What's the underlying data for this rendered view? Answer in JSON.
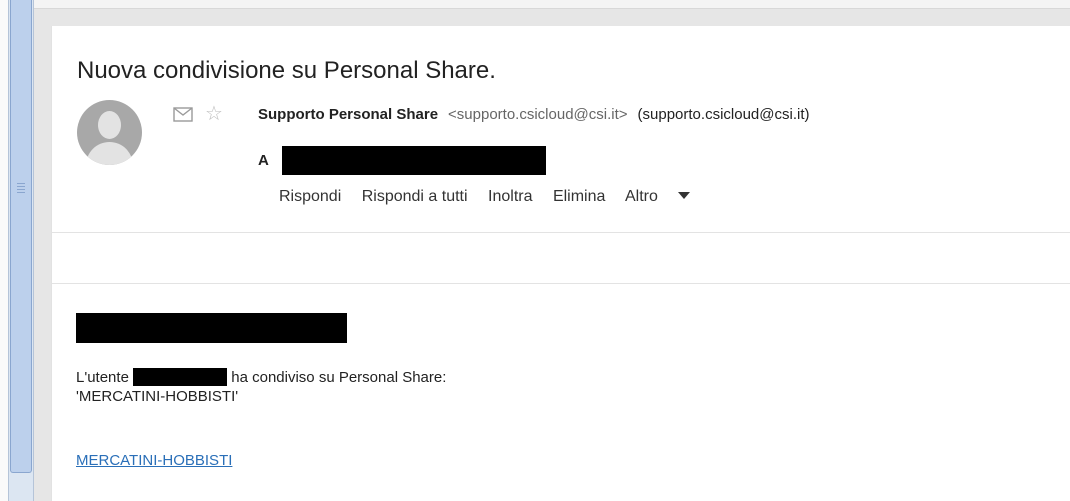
{
  "email": {
    "subject": "Nuova condivisione su Personal Share.",
    "sender_name": "Supporto Personal Share",
    "sender_email": "<supporto.csicloud@csi.it>",
    "sender_email_alt": "(supporto.csicloud@csi.it)",
    "to_label": "A",
    "actions": {
      "reply": "Rispondi",
      "reply_all": "Rispondi a tutti",
      "forward": "Inoltra",
      "delete": "Elimina",
      "more": "Altro"
    },
    "body": {
      "line1_prefix": "L'utente",
      "line1_suffix": "ha condiviso su Personal Share:",
      "line2": "'MERCATINI-HOBBISTI'",
      "link_text": "MERCATINI-HOBBISTI"
    }
  },
  "icons": {
    "envelope": "envelope-icon",
    "star": "star-icon",
    "avatar": "default-avatar-icon",
    "dropdown": "caret-down-icon"
  },
  "colors": {
    "link": "#2a6fb8",
    "redaction": "#000000",
    "scrollbar": "#bcd0ec"
  }
}
